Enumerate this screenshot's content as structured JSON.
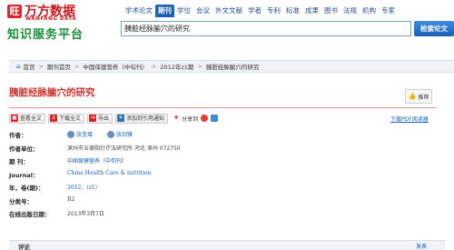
{
  "brand": {
    "logo_mark": "旺",
    "name": "万方数据",
    "name_en": "WANFANG DATA",
    "slogan": "知识服务平台"
  },
  "nav": {
    "tabs": [
      "学术论文",
      "期刊",
      "学位",
      "会议",
      "外文文献",
      "学者",
      "专利",
      "标准",
      "成果",
      "图书",
      "法规",
      "机构",
      "专家"
    ],
    "active": "期刊"
  },
  "search": {
    "value": "胰脏经脉腧穴的研究",
    "button": "检索论文"
  },
  "breadcrumb": [
    "首页",
    "期刊首页",
    "中国保健营养（中旬刊）",
    "2012年z1期",
    "胰脏经脉腧穴的研究"
  ],
  "article": {
    "title": "胰脏经脉腧穴的研究",
    "recommend_label": "推荐"
  },
  "actions": {
    "view_full": "查看全文",
    "download_full": "下载全文",
    "export": "导出",
    "add_alert": "添加到引用通知",
    "share": "分享到",
    "download_reader": "下载PDF阅读器"
  },
  "meta": {
    "author_label": "作者：",
    "authors": [
      "张宝增",
      "张剑锋"
    ],
    "affiliation_label": "作者单位：",
    "affiliation": "涿州市五德指针疗法研究所 河北 涿州 072750",
    "journal_label": "期 刊：",
    "journal": "中国保健营养（中旬刊）",
    "journal_en_label": "Journal：",
    "journal_en": "China Health Care & nutrition",
    "year_label": "年，卷(期)：",
    "year": "2012，(z1)",
    "class_label": "分类号：",
    "class": "R2",
    "online_label": "在线出版日期：",
    "online": "2013年3月7日"
  },
  "comment": {
    "label": "评论",
    "link": "发表"
  }
}
